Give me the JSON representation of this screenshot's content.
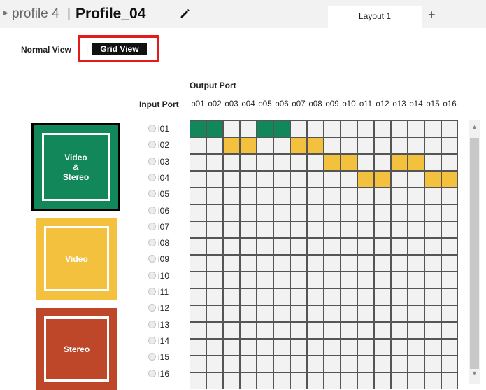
{
  "header": {
    "expand_icon": "triangle-right-icon",
    "profile_label": "profile 4",
    "separator": "|",
    "profile_name": "Profile_04",
    "edit_icon": "pencil-icon",
    "tab_label": "Layout 1",
    "add_tab_label": "+"
  },
  "view_toggle": {
    "normal_label": "Normal View",
    "separator": "|",
    "grid_label": "Grid View",
    "highlight_color": "#e31b1b"
  },
  "matrix": {
    "output_title": "Output Port",
    "input_title": "Input Port",
    "outputs": [
      "o01",
      "o02",
      "o03",
      "o04",
      "o05",
      "o06",
      "o07",
      "o08",
      "o09",
      "o10",
      "o11",
      "o12",
      "o13",
      "o14",
      "o15",
      "o16"
    ],
    "inputs": [
      "i01",
      "i02",
      "i03",
      "i04",
      "i05",
      "i06",
      "i07",
      "i08",
      "i09",
      "i10",
      "i11",
      "i12",
      "i13",
      "i14",
      "i15",
      "i16"
    ],
    "routes": [
      {
        "input": "i01",
        "outputs": [
          "o01",
          "o02",
          "o05",
          "o06"
        ],
        "type": "video-stereo"
      },
      {
        "input": "i02",
        "outputs": [
          "o03",
          "o04",
          "o07",
          "o08"
        ],
        "type": "video"
      },
      {
        "input": "i03",
        "outputs": [
          "o09",
          "o10",
          "o13",
          "o14"
        ],
        "type": "video"
      },
      {
        "input": "i04",
        "outputs": [
          "o11",
          "o12",
          "o15",
          "o16"
        ],
        "type": "video"
      }
    ]
  },
  "legend": [
    {
      "key": "video-stereo",
      "label": "Video\n&\nStereo",
      "color": "#12875a",
      "selected": true
    },
    {
      "key": "video",
      "label": "Video",
      "color": "#f4c13e",
      "selected": false
    },
    {
      "key": "stereo",
      "label": "Stereo",
      "color": "#bd4728",
      "selected": false
    }
  ],
  "colors": {
    "empty_cell": "#f2f2f2",
    "grid_line": "#555555"
  }
}
